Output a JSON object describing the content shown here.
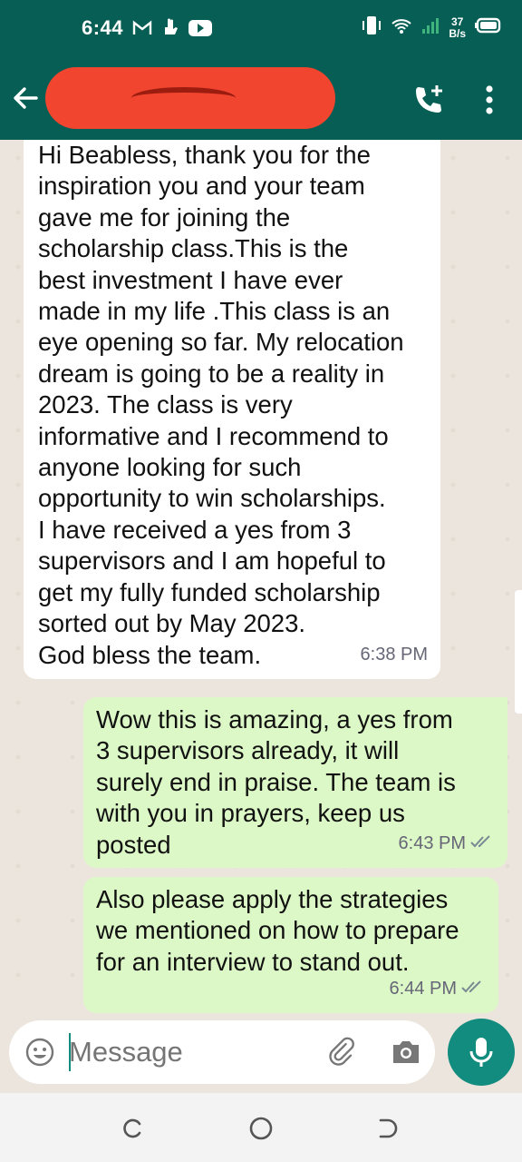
{
  "status_bar": {
    "time": "6:44",
    "net_speed_value": "37",
    "net_speed_unit": "B/s",
    "icons": [
      "gmail-icon",
      "hand-icon",
      "youtube-icon",
      "vibrate-icon",
      "wifi-icon",
      "signal-icon",
      "battery-icon"
    ]
  },
  "header": {
    "contact_name_redacted": true,
    "icons": [
      "back-arrow-icon",
      "add-call-icon",
      "more-vert-icon"
    ]
  },
  "messages": [
    {
      "direction": "incoming",
      "text": "Hi Beabless, thank you for the\ninspiration you and your team\ngave me for joining the\nscholarship class.This is the\nbest investment I have ever\nmade in my life .This class is an\neye opening so far. My relocation\ndream is going to be a reality in\n2023. The class is very\ninformative and I recommend to\nanyone looking for such\nopportunity to win scholarships.\nI have received a yes from 3\nsupervisors and I am hopeful to\nget my fully funded scholarship\nsorted out by May 2023.\nGod bless the team.",
      "time": "6:38 PM"
    },
    {
      "direction": "outgoing",
      "text": "Wow this is amazing, a yes from\n3 supervisors already, it will\nsurely end in praise. The team is\nwith you in prayers, keep us\nposted",
      "time": "6:43 PM",
      "ticks": "read"
    },
    {
      "direction": "outgoing",
      "text": "Also please apply the  strategies\nwe mentioned on how to prepare\nfor an interview to stand out.",
      "time": "6:44 PM",
      "ticks": "read"
    }
  ],
  "composer": {
    "placeholder": "Message",
    "value": ""
  },
  "colors": {
    "header": "#075e54",
    "incoming_bubble": "#ffffff",
    "outgoing_bubble": "#dcf8c6",
    "mic_button": "#128c7e",
    "chat_background": "#ece5dd"
  }
}
